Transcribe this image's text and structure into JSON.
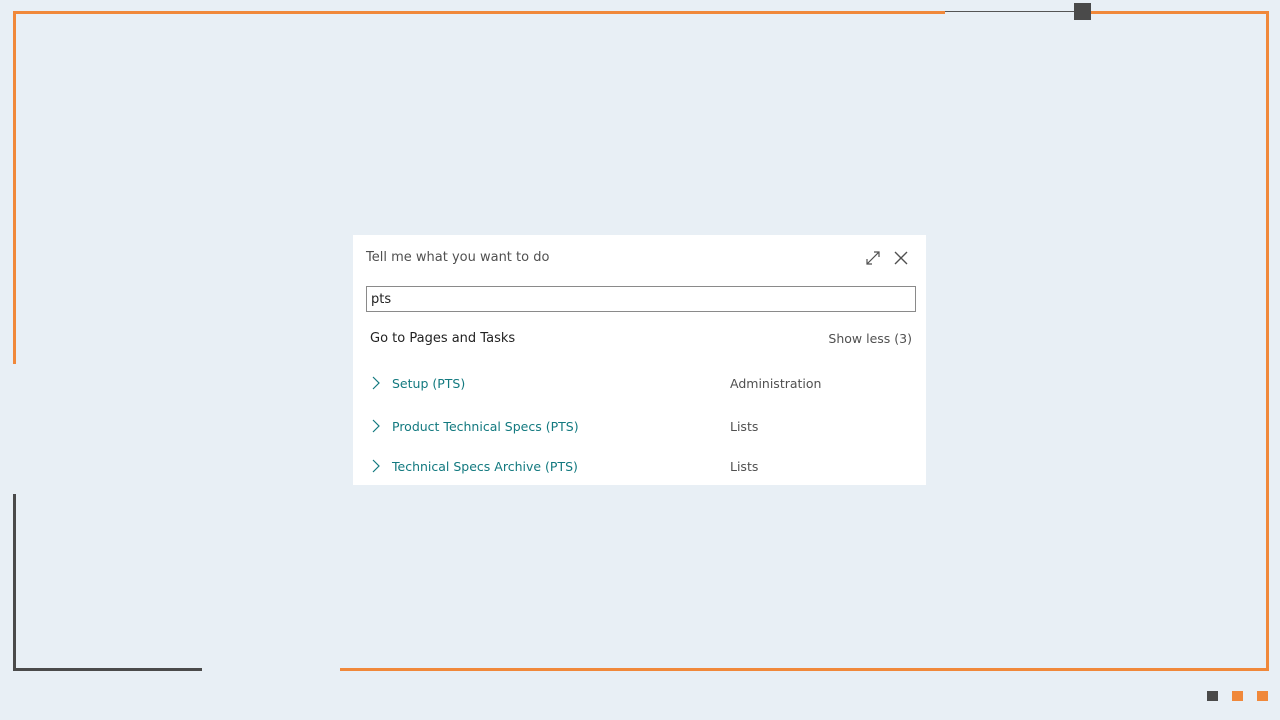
{
  "dialog": {
    "title": "Tell me what you want to do",
    "search_value": "pts",
    "section_header": "Go to Pages and Tasks",
    "show_less": "Show less (3)",
    "results": [
      {
        "label": "Setup (PTS)",
        "category": "Administration"
      },
      {
        "label": "Product Technical Specs (PTS)",
        "category": "Lists"
      },
      {
        "label": "Technical Specs Archive (PTS)",
        "category": "Lists"
      }
    ]
  },
  "colors": {
    "accent_orange": "#f0883a",
    "link_teal": "#12797f",
    "background": "#e8eff5"
  }
}
